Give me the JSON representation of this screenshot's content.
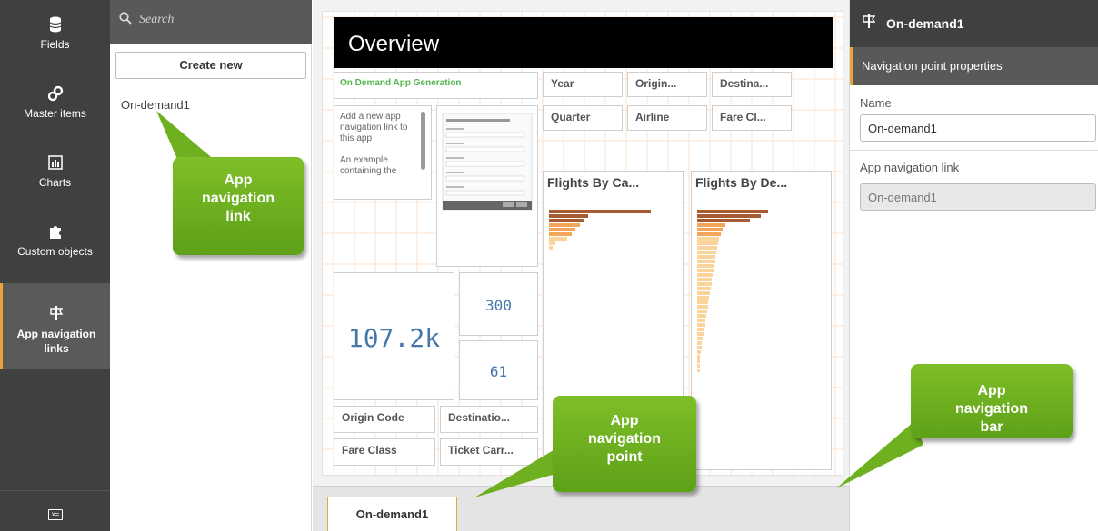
{
  "rail": {
    "items": [
      {
        "label": "Fields",
        "icon": "database-icon"
      },
      {
        "label": "Master items",
        "icon": "link-icon"
      },
      {
        "label": "Charts",
        "icon": "chart-icon"
      },
      {
        "label": "Custom objects",
        "icon": "puzzle-icon"
      },
      {
        "label": "App navigation links",
        "icon": "signpost-icon"
      }
    ],
    "active_index": 4,
    "bottom_icon": "variables-icon"
  },
  "panel": {
    "search_placeholder": "Search",
    "create_label": "Create new",
    "items": [
      "On-demand1"
    ]
  },
  "canvas": {
    "sheet_title": "Overview",
    "app_gen_title": "On Demand App Generation",
    "app_gen_text": "Add a new app navigation link to this app\n\nAn example containing the",
    "filters": {
      "year": "Year",
      "origin": "Origin...",
      "destination": "Destina...",
      "quarter": "Quarter",
      "airline": "Airline",
      "fare": "Fare Cl...",
      "origin_code": "Origin Code",
      "destination_full": "Destinatio...",
      "fare_class": "Fare Class",
      "ticket_carrier": "Ticket Carr..."
    },
    "kpi_main": "107.2k",
    "kpi_top": "300",
    "kpi_bottom": "61",
    "chart1_title": "Flights By Ca...",
    "chart2_title": "Flights By De...",
    "chart1_bars": [
      1.0,
      0.38,
      0.34,
      0.3,
      0.26,
      0.22,
      0.18,
      0.06,
      0.04
    ],
    "chart2_bars": [
      1.0,
      0.9,
      0.74,
      0.4,
      0.36,
      0.33,
      0.31,
      0.29,
      0.28,
      0.27,
      0.26,
      0.25,
      0.24,
      0.23,
      0.22,
      0.21,
      0.2,
      0.19,
      0.18,
      0.17,
      0.16,
      0.15,
      0.14,
      0.13,
      0.12,
      0.11,
      0.1,
      0.09,
      0.08,
      0.07,
      0.06,
      0.05,
      0.04,
      0.03,
      0.03,
      0.02
    ],
    "colors": {
      "dark": "#a65b33",
      "mid": "#f3a65a",
      "light": "#fbd49b"
    }
  },
  "navbar": {
    "point_label": "On-demand1"
  },
  "props": {
    "title": "On-demand1",
    "section": "Navigation point properties",
    "name_label": "Name",
    "name_value": "On-demand1",
    "link_label": "App navigation link",
    "link_value": "On-demand1"
  },
  "callouts": {
    "link": "App navigation link",
    "point": "App navigation point",
    "bar": "App navigation bar"
  }
}
